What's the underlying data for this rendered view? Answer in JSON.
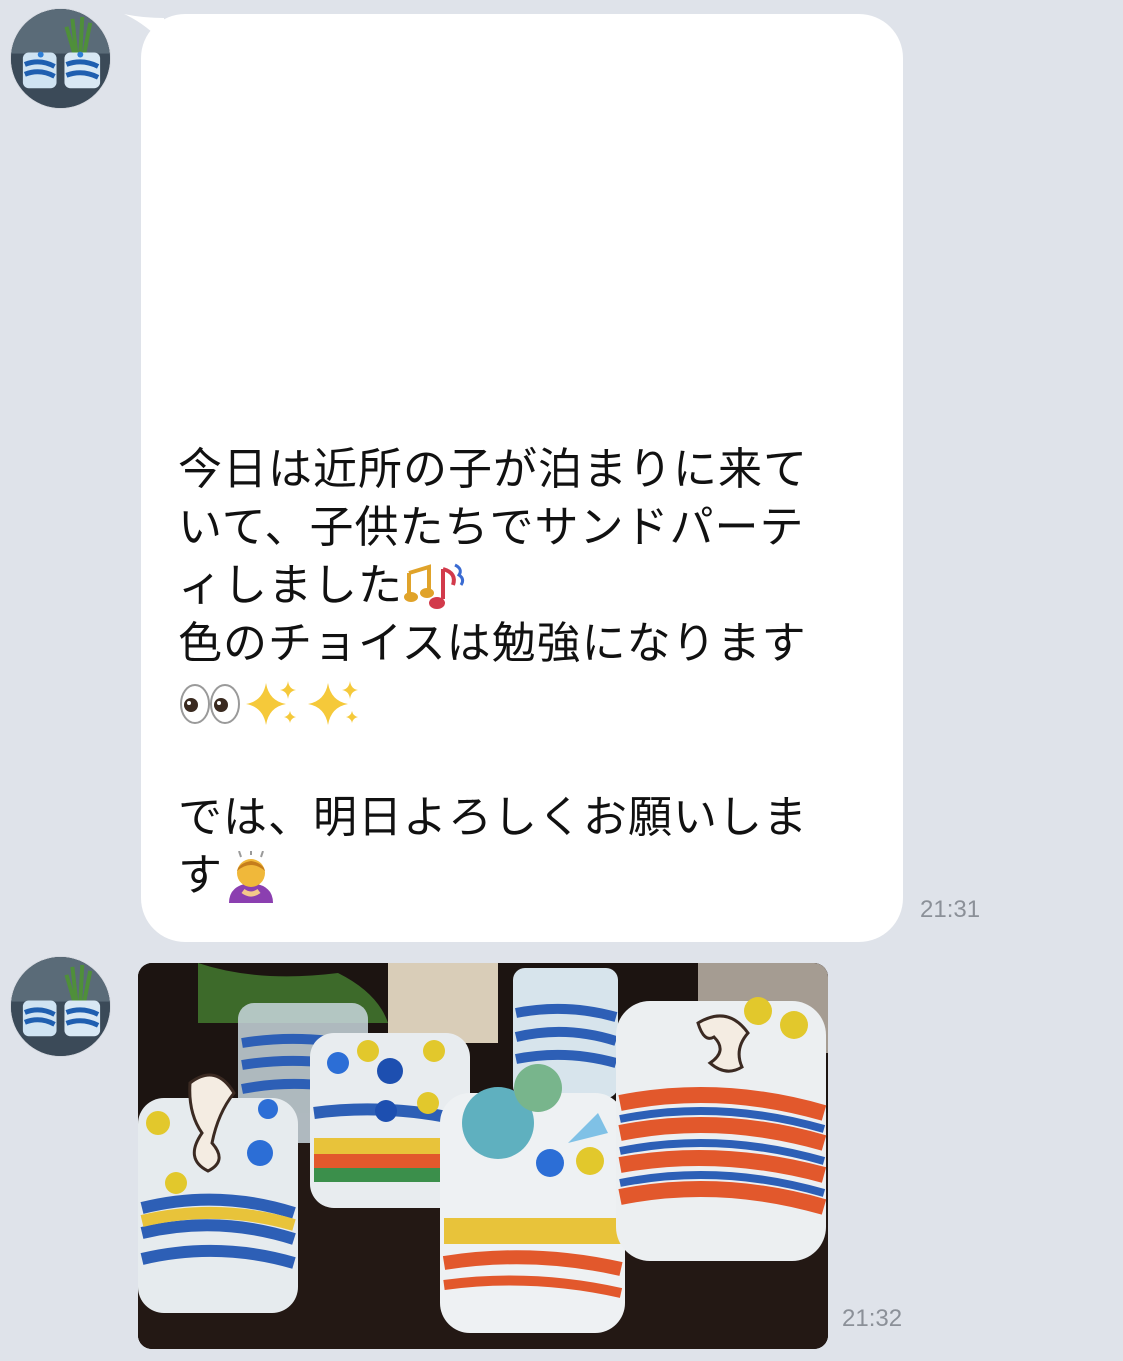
{
  "messages": [
    {
      "type": "text",
      "lines": [
        "今日は近所の子が泊まりに来て",
        "いて、子供たちでサンドパーテ",
        "ィしました",
        "色のチョイスは勉強になります",
        "",
        "",
        "では、明日よろしくお願いしま",
        "す"
      ],
      "emojis": [
        "musical-notes-emoji",
        "eyes-emoji",
        "sparkles-emoji",
        "person-bowing-emoji"
      ],
      "time": "21:31"
    },
    {
      "type": "image",
      "image_description_icon": "sand-art-jars-photo",
      "time": "21:32"
    }
  ],
  "colors": {
    "background": "#dfe3ea",
    "bubble": "#ffffff",
    "timestamp": "#8b9098"
  }
}
